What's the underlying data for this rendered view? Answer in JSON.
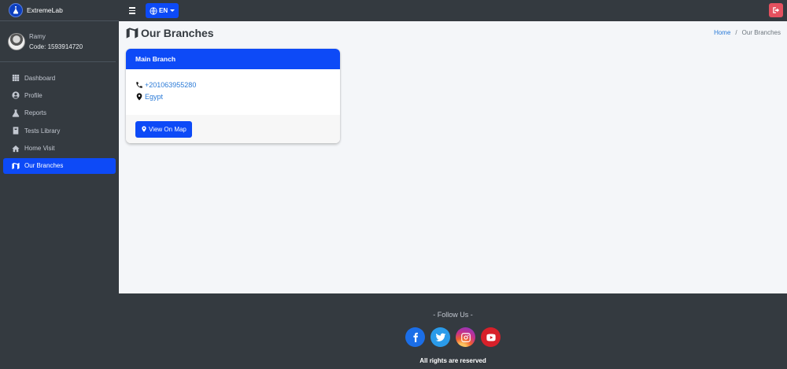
{
  "app": {
    "name": "ExtremeLab"
  },
  "user": {
    "name": "Ramy",
    "code": "Code: 1593914720"
  },
  "sidebar": {
    "items": [
      {
        "label": "Dashboard",
        "icon": "grid-icon"
      },
      {
        "label": "Profile",
        "icon": "user-circle-icon"
      },
      {
        "label": "Reports",
        "icon": "flask-icon"
      },
      {
        "label": "Tests Library",
        "icon": "book-icon"
      },
      {
        "label": "Home Visit",
        "icon": "home-icon"
      },
      {
        "label": "Our Branches",
        "icon": "map-icon",
        "active": true
      }
    ]
  },
  "navbar": {
    "language": "EN"
  },
  "page": {
    "title": "Our Branches"
  },
  "breadcrumb": {
    "home": "Home",
    "separator": "/",
    "current": "Our Branches"
  },
  "branch": {
    "name": "Main Branch",
    "phone": "+201063955280",
    "location": "Egypt",
    "map_button": "View On Map"
  },
  "footer": {
    "follow": "- Follow Us -",
    "socials": [
      "facebook-icon",
      "twitter-icon",
      "instagram-icon",
      "youtube-icon"
    ],
    "rights": "All rights are reserved"
  },
  "colors": {
    "sidebar_bg": "#343a40",
    "accent": "#0d4af7",
    "logout": "#e4515f",
    "link": "#2a7ad7",
    "content_bg": "#f4f6f9"
  }
}
